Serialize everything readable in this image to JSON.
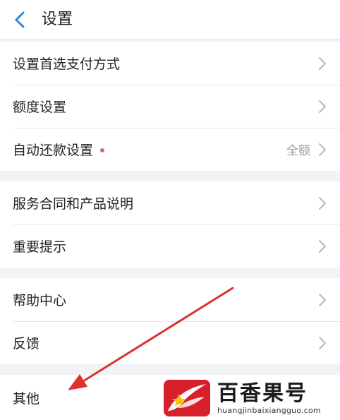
{
  "header": {
    "title": "设置",
    "back_icon": "chevron-left-icon"
  },
  "groups": [
    {
      "items": [
        {
          "label": "设置首选支付方式",
          "value": ""
        },
        {
          "label": "额度设置",
          "value": ""
        },
        {
          "label": "自动还款设置",
          "value": "全额",
          "has_dot": true
        }
      ]
    },
    {
      "items": [
        {
          "label": "服务合同和产品说明",
          "value": ""
        },
        {
          "label": "重要提示",
          "value": ""
        }
      ]
    },
    {
      "items": [
        {
          "label": "帮助中心",
          "value": ""
        },
        {
          "label": "反馈",
          "value": ""
        }
      ]
    },
    {
      "items": [
        {
          "label": "其他",
          "value": ""
        }
      ]
    }
  ],
  "watermark": {
    "title": "百香果号",
    "url": "huangjinbaixiangguo.com"
  },
  "colors": {
    "accent": "#2f86e0",
    "dot": "#e0607a",
    "annotation_arrow": "#e03030",
    "watermark_logo": "#d7202a"
  }
}
